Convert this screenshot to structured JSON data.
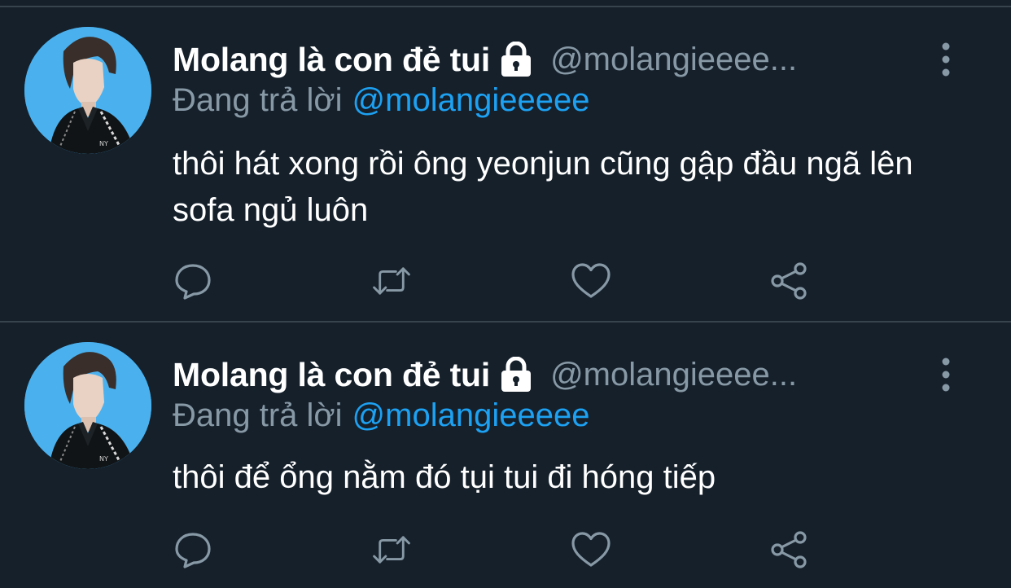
{
  "colors": {
    "background": "#15202b",
    "divider": "#38444d",
    "text_primary": "#ffffff",
    "text_secondary": "#8899a6",
    "accent": "#1da1f2",
    "avatar_background": "#4ab1ee"
  },
  "tweets": [
    {
      "display_name": "Molang là con đẻ tui",
      "protected_icon": "lock-icon",
      "handle": "@molangieeee...",
      "reply_prefix": "Đang trả lời",
      "reply_to": "@molangieeeee",
      "text": "thôi hát xong rồi ông yeonjun cũng gập đầu ngã lên sofa ngủ luôn",
      "actions": [
        "reply-icon",
        "retweet-icon",
        "like-icon",
        "share-icon"
      ]
    },
    {
      "display_name": "Molang là con đẻ tui",
      "protected_icon": "lock-icon",
      "handle": "@molangieeee...",
      "reply_prefix": "Đang trả lời",
      "reply_to": "@molangieeeee",
      "text": "thôi để ổng nằm đó tụi tui đi hóng tiếp",
      "actions": [
        "reply-icon",
        "retweet-icon",
        "like-icon",
        "share-icon"
      ]
    }
  ]
}
